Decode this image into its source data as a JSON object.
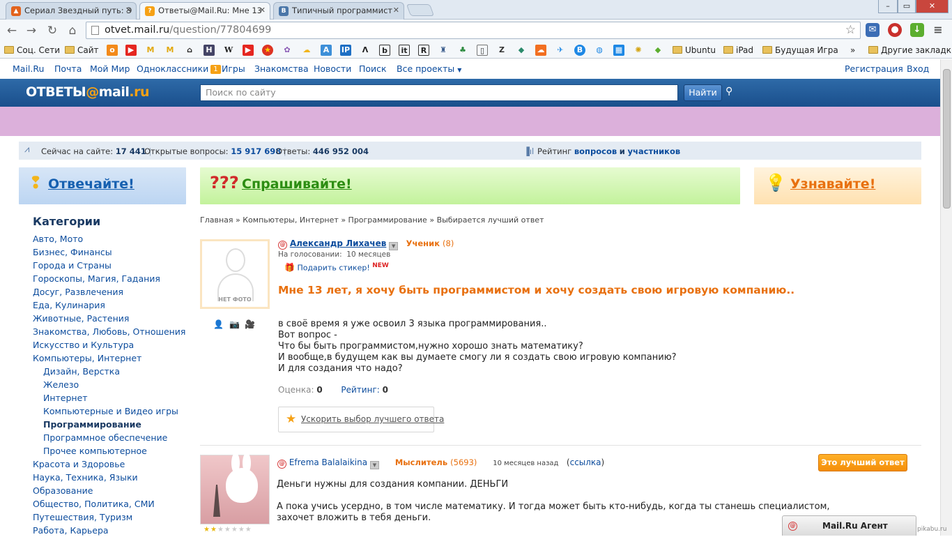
{
  "browser": {
    "tabs": [
      {
        "title": "Сериал Звездный путь: Э",
        "active": false
      },
      {
        "title": "Ответы@Mail.Ru: Мне 13",
        "active": true
      },
      {
        "title": "Типичный программист",
        "active": false
      }
    ],
    "url_host": "otvet.mail.ru",
    "url_path": "/question/77804699",
    "bookmarks": [
      {
        "label": "Соц. Сети"
      },
      {
        "label": "Сайт"
      },
      {
        "label": "Ubuntu"
      },
      {
        "label": "iPad"
      },
      {
        "label": "Будущая Игра"
      },
      {
        "label": "»"
      },
      {
        "label": "Другие закладки"
      }
    ],
    "window_buttons": {
      "minimize": "–",
      "maximize": "▭",
      "close": "✕"
    }
  },
  "portal_nav": {
    "items": [
      "Mail.Ru",
      "Почта",
      "Мой Мир",
      "Одноклассники",
      "Игры",
      "Знакомства",
      "Новости",
      "Поиск",
      "Все проекты"
    ],
    "odnoklassniki_badge": "1",
    "register": "Регистрация",
    "login": "Вход"
  },
  "header": {
    "logo_part1": "ОТВЕТЫ",
    "logo_at": "@",
    "logo_part2": "mail",
    "logo_ru": ".ru",
    "search_placeholder": "Поиск по сайту",
    "search_button": "Найти"
  },
  "stats": {
    "online_label": "Сейчас на сайте:",
    "online_value": "17 441",
    "open_label": "Открытые вопросы:",
    "open_value": "15 917 698",
    "answers_label": "Ответы:",
    "answers_value": "446 952 004",
    "rating_label": "Рейтинг",
    "rating_questions": "вопросов",
    "rating_and": "и",
    "rating_users": "участников"
  },
  "blocks": {
    "answer": "Отвечайте!",
    "ask": "Спрашивайте!",
    "learn": "Узнавайте!"
  },
  "categories": {
    "title": "Категории",
    "items": [
      {
        "label": "Авто, Мото"
      },
      {
        "label": "Бизнес, Финансы"
      },
      {
        "label": "Города и Страны"
      },
      {
        "label": "Гороскопы, Магия, Гадания"
      },
      {
        "label": "Досуг, Развлечения"
      },
      {
        "label": "Еда, Кулинария"
      },
      {
        "label": "Животные, Растения"
      },
      {
        "label": "Знакомства, Любовь, Отношения"
      },
      {
        "label": "Искусство и Культура"
      },
      {
        "label": "Компьютеры, Интернет"
      },
      {
        "label": "Дизайн, Верстка"
      },
      {
        "label": "Железо"
      },
      {
        "label": "Интернет"
      },
      {
        "label": "Компьютерные и Видео игры"
      },
      {
        "label": "Программирование"
      },
      {
        "label": "Программное обеспечение"
      },
      {
        "label": "Прочее компьютерное"
      },
      {
        "label": "Красота и Здоровье"
      },
      {
        "label": "Наука, Техника, Языки"
      },
      {
        "label": "Образование"
      },
      {
        "label": "Общество, Политика, СМИ"
      },
      {
        "label": "Путешествия, Туризм"
      },
      {
        "label": "Работа, Карьера"
      }
    ]
  },
  "breadcrumb": {
    "home": "Главная",
    "sep": "»",
    "cat": "Компьютеры, Интернет",
    "sub": "Программирование",
    "current": "Выбирается лучший ответ"
  },
  "question": {
    "no_photo": "НЕТ ФОТО",
    "author": "Александр Лихачев",
    "rank": "Ученик",
    "rank_points": "(8)",
    "voting": "На голосовании:  10 месяцев",
    "gift": "Подарить стикер!",
    "gift_new": "NEW",
    "title": "Мне 13 лет, я хочу быть программистом и хочу создать свою игровую компанию..",
    "body": [
      "в своё время я уже освоил 3 языка программирования..",
      "Вот вопрос -",
      "Что бы быть программистом,нужно хорошо знать математику?",
      "И вообще,в будущем как вы думаете смогу ли я создать свою игровую компанию?",
      "И для создания что надо?"
    ],
    "score_label": "Оценка:",
    "score_value": "0",
    "rating_label": "Рейтинг:",
    "rating_value": "0",
    "speedup": "Ускорить выбор лучшего ответа"
  },
  "answer": {
    "author": "Efrema Balalaikina",
    "rank": "Мыслитель",
    "rank_points": "(5693)",
    "time": "10 месяцев назад",
    "link": "ссылка",
    "best_button": "Это лучший ответ",
    "stars_filled": 2,
    "stars_total": 7,
    "body": [
      "Деньги нужны для создания компании. ДЕНЬГИ",
      "",
      "А пока учись усердно, в том числе математику. И тогда может быть кто-нибудь, когда ты станешь специалистом,",
      "захочет вложить в тебя деньги."
    ]
  },
  "agent": {
    "label": "Mail.Ru Агент"
  },
  "watermark": "pikabu.ru",
  "colors": {
    "accent": "#e8700f",
    "link": "#0c4c9d",
    "header": "#1a4f8c",
    "banner": "#dcb0db"
  }
}
